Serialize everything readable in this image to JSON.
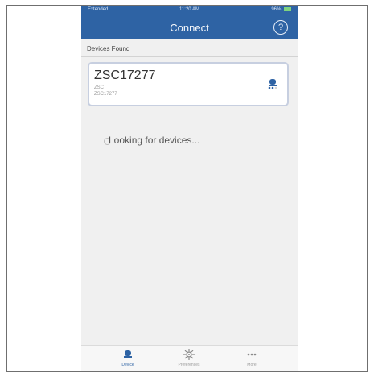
{
  "status_bar": {
    "carrier": "Extended",
    "time": "11:20 AM",
    "battery": "96%"
  },
  "header": {
    "title": "Connect",
    "help_icon": "?"
  },
  "section": {
    "devices_found_label": "Devices Found"
  },
  "device_card": {
    "name": "ZSC17277",
    "line1": "ZSC",
    "line2": "ZSC17277",
    "icon": "device-icon"
  },
  "loading": {
    "text": "Looking for devices..."
  },
  "tabs": [
    {
      "label": "Device",
      "icon": "device-icon"
    },
    {
      "label": "Preferences",
      "icon": "gear-icon"
    },
    {
      "label": "More",
      "icon": "more-icon"
    }
  ],
  "colors": {
    "header_bg": "#2e63a4",
    "active_tab": "#2e63a4",
    "card_border": "#c7cfe0"
  }
}
